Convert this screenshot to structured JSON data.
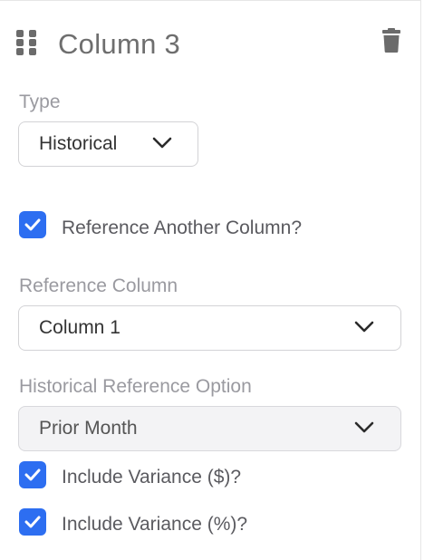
{
  "header": {
    "title": "Column 3",
    "drag_icon": "drag-handle-icon",
    "delete_icon": "trash-icon"
  },
  "type_field": {
    "label": "Type",
    "value": "Historical"
  },
  "reference_checkbox": {
    "label": "Reference Another Column?",
    "checked": true
  },
  "reference_column": {
    "label": "Reference Column",
    "value": "Column 1"
  },
  "historical_option": {
    "label": "Historical Reference Option",
    "value": "Prior Month",
    "disabled": true
  },
  "variance_dollar": {
    "label": "Include Variance ($)?",
    "checked": true
  },
  "variance_percent": {
    "label": "Include Variance (%)?",
    "checked": true
  },
  "colors": {
    "accent": "#2d6ef1",
    "label_gray": "#9a9aa0",
    "title_gray": "#6e6e6e"
  }
}
